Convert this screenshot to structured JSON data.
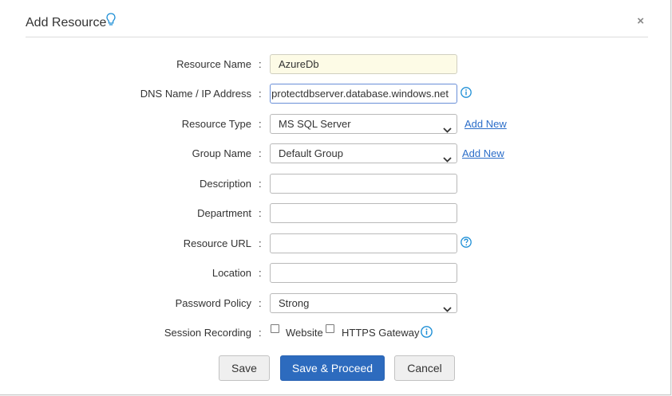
{
  "dialog": {
    "title": "Add Resource",
    "close_symbol": "×"
  },
  "form": {
    "colon": ":",
    "resource_name": {
      "label": "Resource Name",
      "value": "AzureDb"
    },
    "dns_name": {
      "label": "DNS Name / IP Address",
      "value": "protectdbserver.database.windows.net"
    },
    "resource_type": {
      "label": "Resource Type",
      "selected": "MS SQL Server",
      "add_new": "Add New"
    },
    "group_name": {
      "label": "Group Name",
      "selected": "Default Group",
      "add_new": "Add New"
    },
    "description": {
      "label": "Description",
      "value": ""
    },
    "department": {
      "label": "Department",
      "value": ""
    },
    "resource_url": {
      "label": "Resource URL",
      "value": ""
    },
    "location": {
      "label": "Location",
      "value": ""
    },
    "password_policy": {
      "label": "Password Policy",
      "selected": "Strong"
    },
    "session_recording": {
      "label": "Session Recording",
      "website": "Website",
      "https_gateway": "HTTPS Gateway"
    }
  },
  "buttons": {
    "save": "Save",
    "save_proceed": "Save & Proceed",
    "cancel": "Cancel"
  },
  "colors": {
    "primary": "#2d6bbe",
    "link": "#2c6ec9",
    "info": "#1e8fd6",
    "filled_bg": "#fdfbe6"
  },
  "icons": [
    "lightbulb-icon",
    "close-icon",
    "info-icon",
    "help-icon",
    "chevron-down-icon"
  ]
}
